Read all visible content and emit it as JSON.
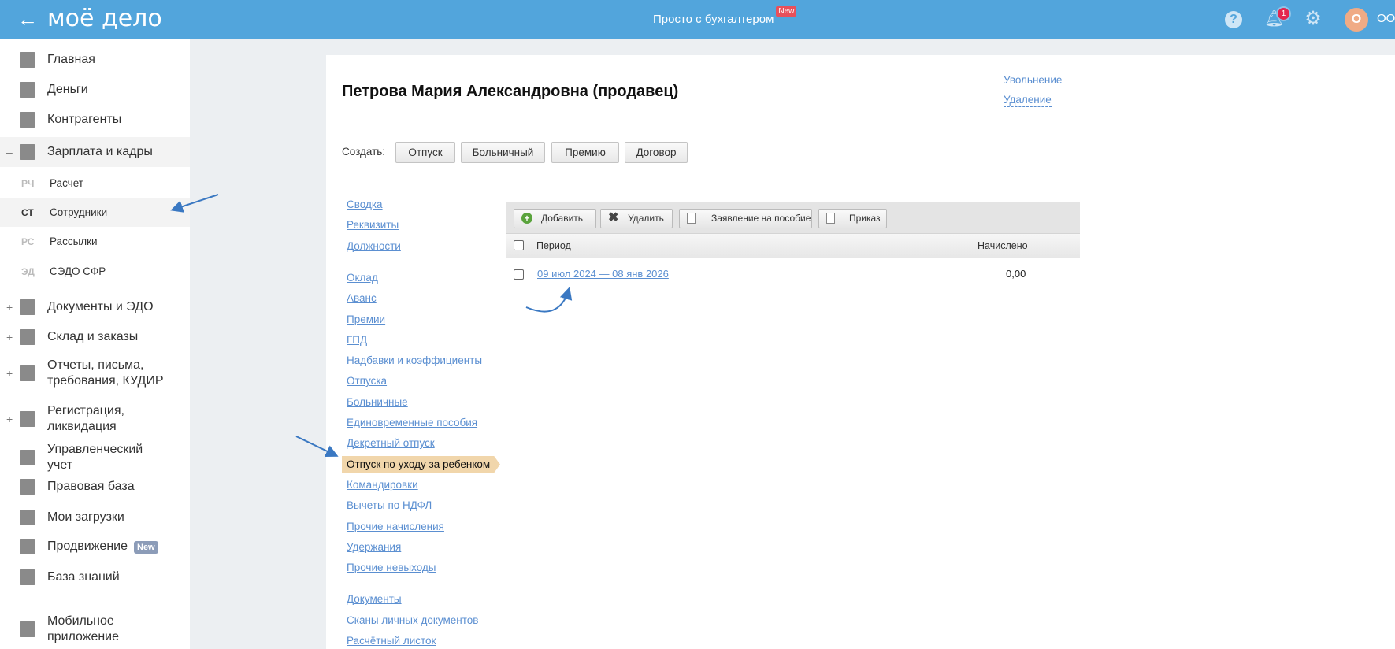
{
  "header": {
    "logo": "моё дело",
    "promo": "Просто с бухгалтером",
    "promo_badge": "New",
    "notifications": "1",
    "avatar": "О",
    "org": "ООО"
  },
  "sidebar": {
    "items": [
      {
        "label": "Главная",
        "icon": "home-icon"
      },
      {
        "label": "Деньги",
        "icon": "money-icon"
      },
      {
        "label": "Контрагенты",
        "icon": "contractors-icon"
      },
      {
        "label": "Зарплата и кадры",
        "icon": "wallet-icon",
        "toggle": "–"
      },
      {
        "label": "Документы и ЭДО",
        "icon": "folder-icon",
        "toggle": "+"
      },
      {
        "label": "Склад и заказы",
        "icon": "warehouse-icon",
        "toggle": "+"
      },
      {
        "label": "Отчеты, письма, требования, КУДИР",
        "icon": "report-icon",
        "toggle": "+"
      },
      {
        "label": "Регистрация, ликвидация",
        "icon": "registration-icon",
        "toggle": "+"
      },
      {
        "label": "Управленческий учет",
        "icon": "ruble-icon"
      },
      {
        "label": "Правовая база",
        "icon": "briefcase-icon"
      },
      {
        "label": "Мои загрузки",
        "icon": "folder-icon"
      },
      {
        "label": "Продвижение",
        "icon": "chart-icon",
        "badge": "New"
      },
      {
        "label": "База знаний",
        "icon": "graduation-icon"
      },
      {
        "label": "Мобильное приложение",
        "icon": "mobile-icon"
      }
    ],
    "subitems": [
      {
        "abbr": "РЧ",
        "label": "Расчет"
      },
      {
        "abbr": "СТ",
        "label": "Сотрудники"
      },
      {
        "abbr": "РС",
        "label": "Рассылки"
      },
      {
        "abbr": "ЭД",
        "label": "СЭДО СФР"
      }
    ]
  },
  "employee": {
    "title": "Петрова Мария Александровна (продавец)",
    "dismiss": "Увольнение",
    "delete": "Удаление"
  },
  "create": {
    "label": "Создать:",
    "buttons": [
      "Отпуск",
      "Больничный",
      "Премию",
      "Договор"
    ]
  },
  "menu": {
    "group1": [
      "Сводка",
      "Реквизиты",
      "Должности"
    ],
    "group2": [
      "Оклад",
      "Аванс",
      "Премии",
      "ГПД",
      "Надбавки и коэффициенты",
      "Отпуска",
      "Больничные",
      "Единовременные пособия",
      "Декретный отпуск",
      "Отпуск по уходу за ребенком",
      "Командировки",
      "Вычеты по НДФЛ",
      "Прочие начисления",
      "Удержания",
      "Прочие невыходы"
    ],
    "group3": [
      "Документы",
      "Сканы личных документов",
      "Расчётный листок"
    ],
    "active": "Отпуск по уходу за ребенком"
  },
  "grid": {
    "toolbar": [
      "Добавить",
      "Удалить",
      "Заявление на пособие",
      "Приказ"
    ],
    "columns": [
      "Период",
      "Начислено"
    ],
    "rows": [
      {
        "period": "09 июл 2024 — 08 янв 2026",
        "amount": "0,00"
      }
    ]
  },
  "colors": {
    "header": "#52a5dc",
    "link": "#5b8fd1",
    "active": "#f1d6ab",
    "arrow": "#3a78c2"
  }
}
